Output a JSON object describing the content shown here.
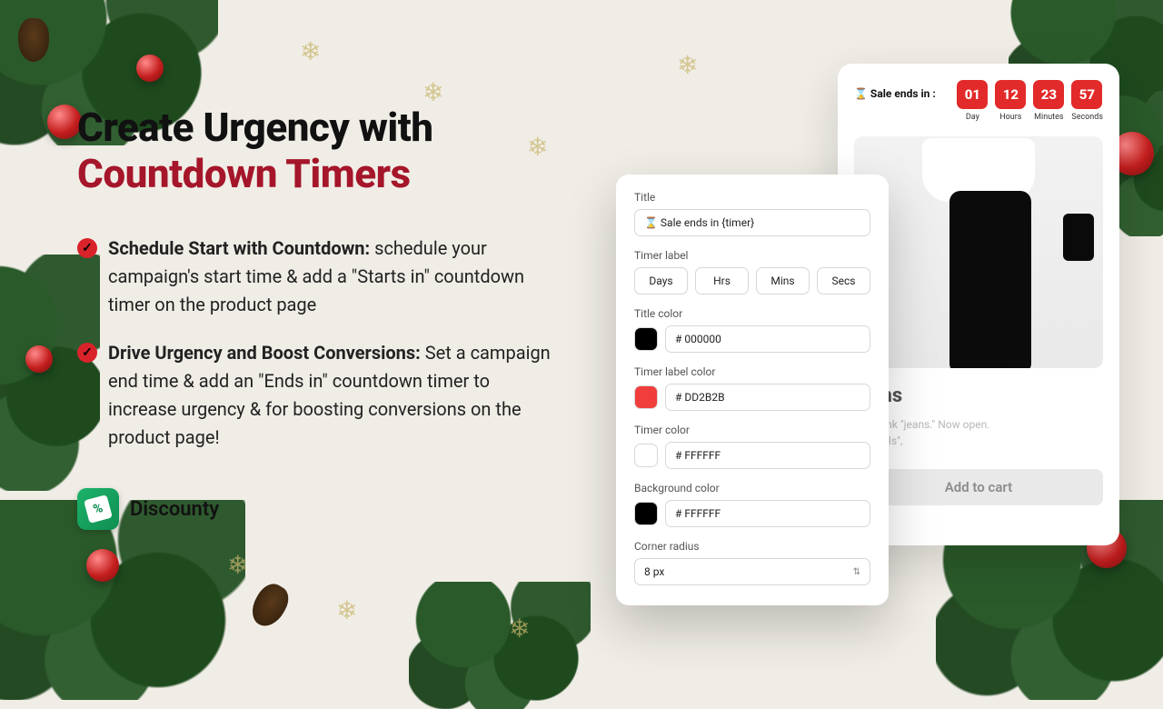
{
  "headline": {
    "line1": "Create Urgency with",
    "line2": "Countdown Timers"
  },
  "bullets": [
    {
      "title": "Schedule Start with Countdown:",
      "body": " schedule your campaign's start time & add a \"Starts in\" countdown timer on the product page"
    },
    {
      "title": "Drive Urgency and Boost Conversions:",
      "body": " Set a campaign end time & add an \"Ends in\" countdown timer to increase urgency & for boosting conversions on the product page!"
    }
  ],
  "brand": {
    "name": "Discounty",
    "badge_symbol": "%"
  },
  "preview": {
    "sale_label": "⌛ Sale ends in :",
    "countdown": [
      {
        "value": "01",
        "unit": "Day"
      },
      {
        "value": "12",
        "unit": "Hours"
      },
      {
        "value": "23",
        "unit": "Minutes"
      },
      {
        "value": "57",
        "unit": "Seconds"
      }
    ],
    "product_title": "jeans",
    "product_desc_l1": "es. Think \"jeans.\" Now open.",
    "product_desc_l2": "Originals\",",
    "add_to_cart": "Add to cart"
  },
  "settings": {
    "title": {
      "label": "Title",
      "value": "⌛ Sale ends in {timer}"
    },
    "timer_labels": {
      "label": "Timer label",
      "values": [
        "Days",
        "Hrs",
        "Mins",
        "Secs"
      ]
    },
    "title_color": {
      "label": "Title color",
      "value": "# 000000",
      "swatch": "#000000"
    },
    "timer_label_color": {
      "label": "Timer label color",
      "value": "# DD2B2B",
      "swatch": "#f23d3d"
    },
    "timer_color": {
      "label": "Timer  color",
      "value": "# FFFFFF",
      "swatch": "#ffffff"
    },
    "background_color": {
      "label": "Background color",
      "value": "# FFFFFF",
      "swatch": "#000000"
    },
    "corner_radius": {
      "label": "Corner radius",
      "value": "8 px"
    }
  },
  "colors": {
    "accent": "#a5162a",
    "timer_block": "#e22a2a",
    "brand": "#1db36a"
  }
}
